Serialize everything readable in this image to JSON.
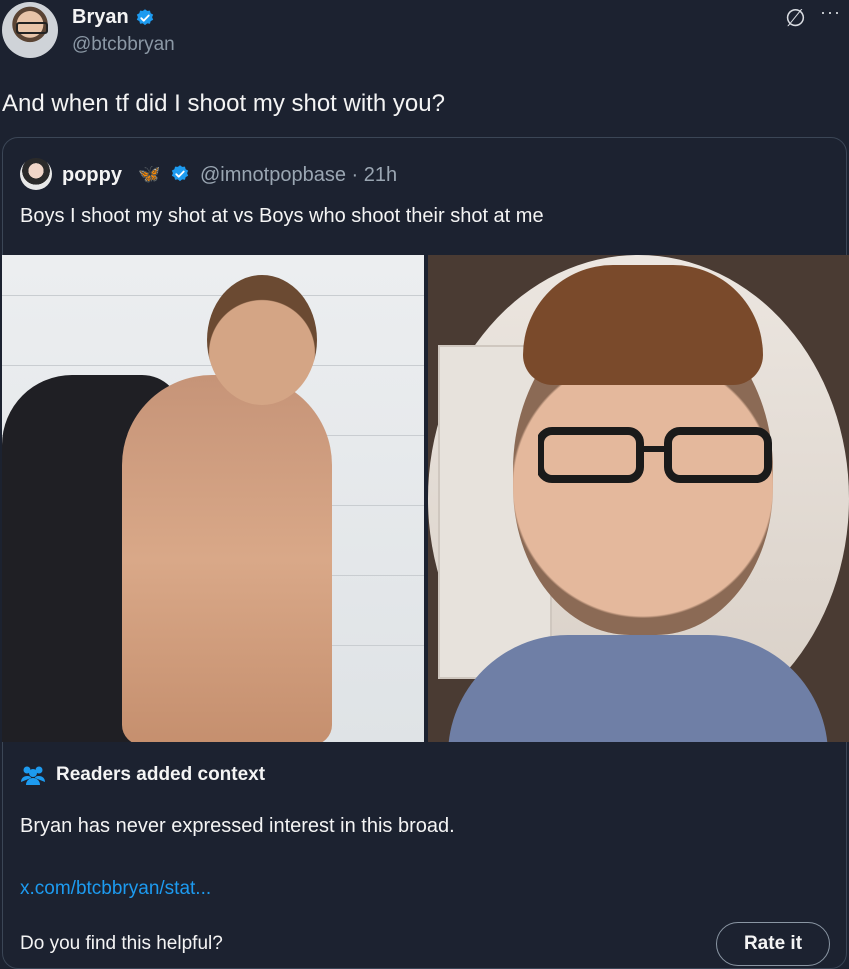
{
  "author": {
    "name": "Bryan",
    "handle": "@btcbbryan",
    "verified_color": "#1d9bf0"
  },
  "tweet": {
    "text": "And when tf did I shoot my shot with you?"
  },
  "header_icons": {
    "grok_icon": "∅",
    "more_icon": "···"
  },
  "quote": {
    "name": "poppy",
    "emoji": "🦋",
    "handle_time": "@imnotpopbase · 21h",
    "text": "Boys I shoot my shot at vs Boys who shoot their shot at me"
  },
  "community_note": {
    "title": "Readers added context",
    "body": "Bryan has  never expressed interest in this broad.",
    "link": "x.com/btcbbryan/stat...",
    "helpful_prompt": "Do you find this helpful?",
    "rate_button": "Rate it"
  },
  "colors": {
    "background": "#1c2230",
    "text": "#e7e9ea",
    "muted": "#8b98a5",
    "link": "#1d9bf0"
  }
}
